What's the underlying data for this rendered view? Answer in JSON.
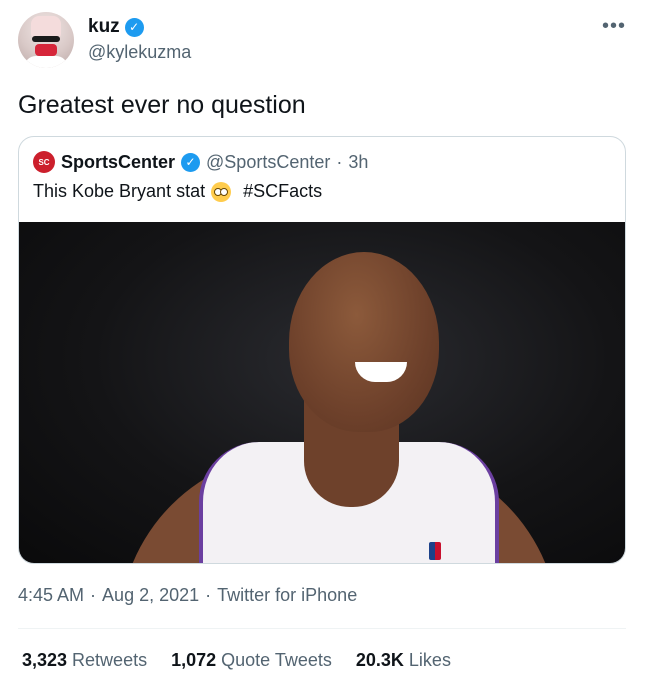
{
  "author": {
    "name": "kuz",
    "handle": "@kylekuzma",
    "avatar_icon": "user-avatar"
  },
  "more_label": "•••",
  "tweet_text": "Greatest ever no question",
  "quoted": {
    "logo": "SC",
    "name": "SportsCenter",
    "handle": "@SportsCenter",
    "separator": "·",
    "time": "3h",
    "text": "This Kobe Bryant stat",
    "emoji_icon": "flushed-face-emoji",
    "hashtag": "#SCFacts",
    "media_icon": "photo-kobe-bryant-smiling"
  },
  "meta": {
    "time": "4:45 AM",
    "date": "Aug 2, 2021",
    "client": "Twitter for iPhone",
    "separator": "·"
  },
  "stats": [
    {
      "count": "3,323",
      "label": "Retweets"
    },
    {
      "count": "1,072",
      "label": "Quote Tweets"
    },
    {
      "count": "20.3K",
      "label": "Likes"
    }
  ],
  "colors": {
    "verified": "#1d9bf0",
    "secondary_text": "#536471",
    "primary_text": "#0f1419",
    "border": "#cfd9de",
    "espn_red": "#cc1f2c"
  }
}
